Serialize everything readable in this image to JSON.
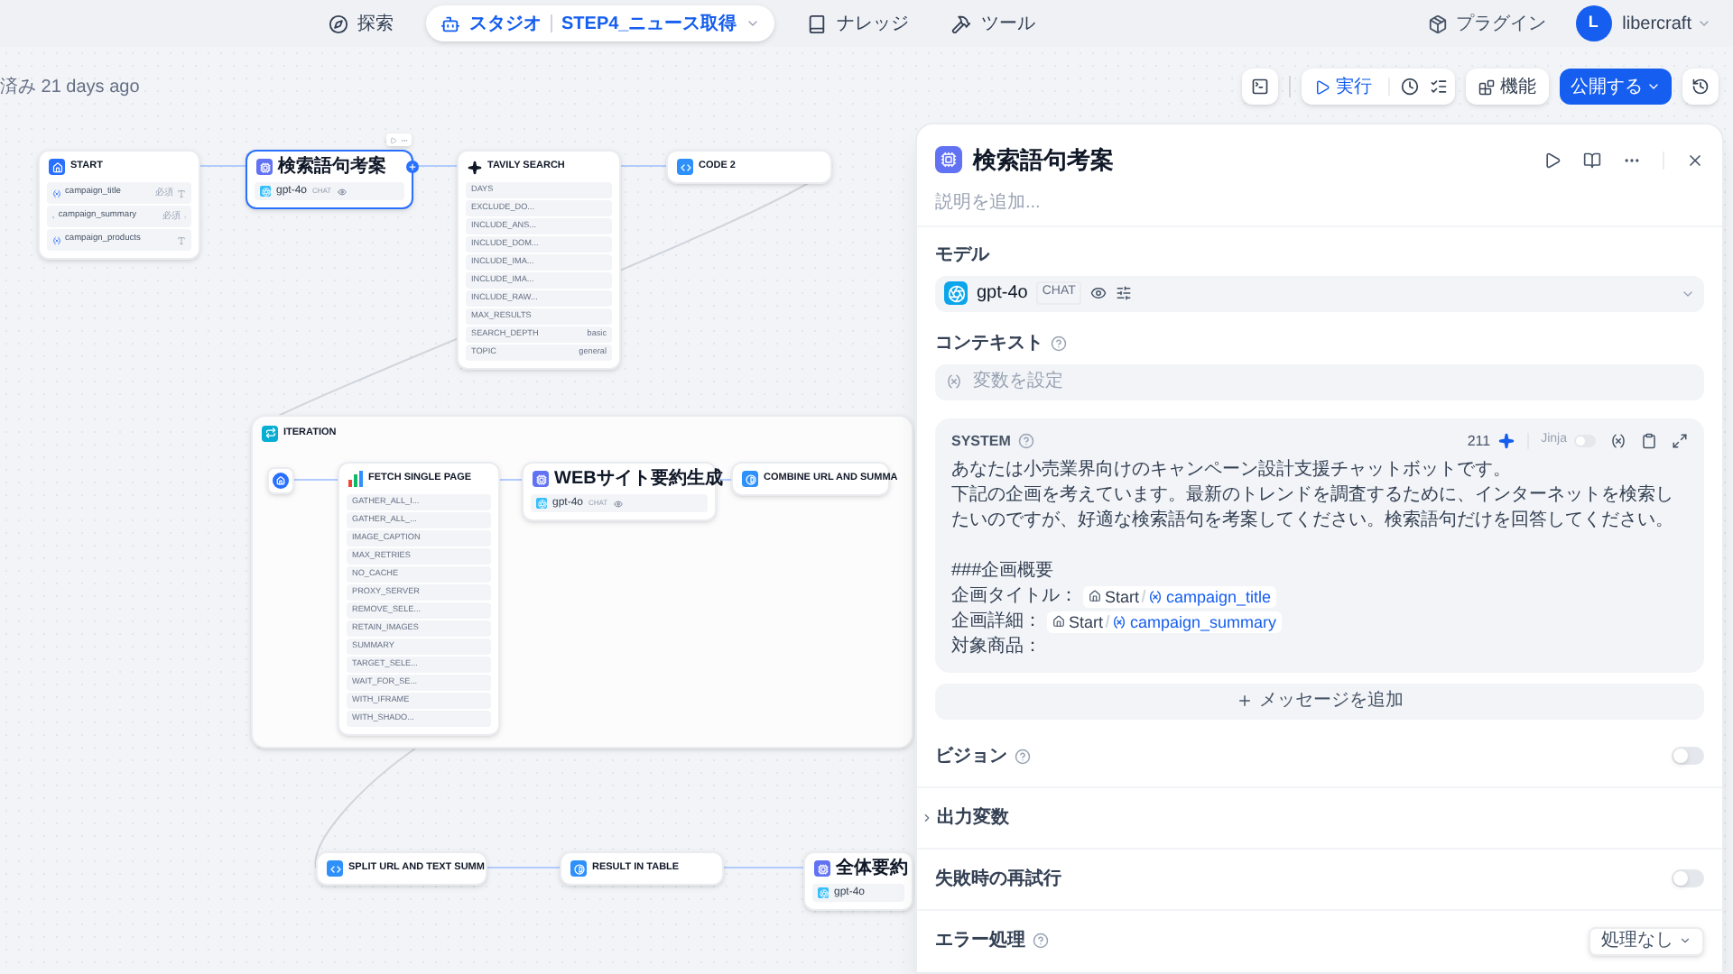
{
  "nav": {
    "items": [
      {
        "kind": "explore",
        "label": "探索",
        "selected": false
      },
      {
        "kind": "studio",
        "label": "スタジオ",
        "selected": true,
        "app": "STEP4_ニュース取得"
      },
      {
        "kind": "knowledge",
        "label": "ナレッジ",
        "selected": false
      },
      {
        "kind": "tools",
        "label": "ツール",
        "selected": false
      }
    ],
    "plugins": "プラグイン",
    "user": {
      "initial": "L",
      "name": "libercraft"
    }
  },
  "canvas": {
    "saved_status": "済み 21 days ago",
    "toolbar": {
      "run": "実行",
      "features": "機能",
      "publish": "公開する"
    },
    "nodes": [
      {
        "kind": "start",
        "title": "START",
        "selected": false,
        "rows": [
          {
            "kind": "input",
            "label": "campaign_title",
            "badge": "必須"
          },
          {
            "kind": "input",
            "label": "campaign_summary",
            "badge": "必須"
          },
          {
            "kind": "input",
            "label": "campaign_products"
          }
        ]
      },
      {
        "kind": "llm",
        "title": "検索語句考案",
        "selected": true,
        "rows": [
          {
            "kind": "model",
            "label": "gpt-4o",
            "badge": "CHAT"
          }
        ]
      },
      {
        "kind": "tavily",
        "title": "TAVILY SEARCH",
        "selected": false,
        "rows": [
          {
            "kind": "param",
            "label": "DAYS"
          },
          {
            "kind": "param",
            "label": "EXCLUDE_DO..."
          },
          {
            "kind": "param",
            "label": "INCLUDE_ANS..."
          },
          {
            "kind": "param",
            "label": "INCLUDE_DOM..."
          },
          {
            "kind": "param",
            "label": "INCLUDE_IMA..."
          },
          {
            "kind": "param",
            "label": "INCLUDE_IMA..."
          },
          {
            "kind": "param",
            "label": "INCLUDE_RAW..."
          },
          {
            "kind": "param",
            "label": "MAX_RESULTS"
          },
          {
            "kind": "param",
            "label": "SEARCH_DEPTH",
            "value": "basic"
          },
          {
            "kind": "param",
            "label": "TOPIC",
            "value": "general"
          }
        ]
      },
      {
        "kind": "code",
        "title": "CODE 2",
        "selected": false
      },
      {
        "kind": "code",
        "title": "SPLIT URL AND TEXT SUMM",
        "selected": false
      },
      {
        "kind": "template",
        "title": "RESULT IN TABLE",
        "selected": false
      },
      {
        "kind": "llm",
        "title": "全体要約",
        "selected": false,
        "rows": [
          {
            "kind": "model",
            "label": "gpt-4o"
          }
        ]
      }
    ],
    "iteration": {
      "title": "ITERATION",
      "nodes": [
        {
          "kind": "iteration-start",
          "selected": false
        },
        {
          "kind": "fetch",
          "title": "FETCH SINGLE PAGE",
          "selected": false,
          "rows": [
            {
              "kind": "param",
              "label": "GATHER_ALL_I..."
            },
            {
              "kind": "param",
              "label": "GATHER_ALL_..."
            },
            {
              "kind": "param",
              "label": "IMAGE_CAPTION"
            },
            {
              "kind": "param",
              "label": "MAX_RETRIES"
            },
            {
              "kind": "param",
              "label": "NO_CACHE"
            },
            {
              "kind": "param",
              "label": "PROXY_SERVER"
            },
            {
              "kind": "param",
              "label": "REMOVE_SELE..."
            },
            {
              "kind": "param",
              "label": "RETAIN_IMAGES"
            },
            {
              "kind": "param",
              "label": "SUMMARY"
            },
            {
              "kind": "param",
              "label": "TARGET_SELE..."
            },
            {
              "kind": "param",
              "label": "WAIT_FOR_SE..."
            },
            {
              "kind": "param",
              "label": "WITH_IFRAME"
            },
            {
              "kind": "param",
              "label": "WITH_SHADO..."
            }
          ]
        },
        {
          "kind": "llm",
          "title": "WEBサイト要約生成",
          "selected": false,
          "rows": [
            {
              "kind": "model",
              "label": "gpt-4o",
              "badge": "CHAT"
            }
          ]
        },
        {
          "kind": "template",
          "title": "COMBINE URL AND SUMMA",
          "selected": false
        }
      ]
    }
  },
  "panel": {
    "title": "検索語句考案",
    "description_placeholder": "説明を追加...",
    "model": {
      "label": "モデル",
      "name": "gpt-4o",
      "mode": "CHAT"
    },
    "context": {
      "label": "コンテキスト",
      "placeholder": "変数を設定"
    },
    "system": {
      "role": "SYSTEM",
      "count": "211",
      "jinja": {
        "label": "Jinja",
        "on": false
      },
      "lines": [
        {
          "kind": "text",
          "text": "あなたは小売業界向けのキャンペーン設計支援チャットボットです。"
        },
        {
          "kind": "text",
          "text": "下記の企画を考えています。最新のトレンドを調査するために、インターネットを検索したいのですが、好適な検索語句を考案してください。検索語句だけを回答してください。"
        },
        {
          "kind": "blank"
        },
        {
          "kind": "text",
          "text": "###企画概要"
        },
        {
          "kind": "var",
          "label": "企画タイトル：",
          "node": "Start",
          "variable": "campaign_title"
        },
        {
          "kind": "var",
          "label": "企画詳細：",
          "node": "Start",
          "variable": "campaign_summary"
        },
        {
          "kind": "text",
          "text": "対象商品："
        }
      ]
    },
    "add_message": "メッセージを追加",
    "settings": [
      {
        "kind": "toggle",
        "label": "ビジョン",
        "help": true,
        "on": false
      },
      {
        "kind": "section",
        "label": "出力変数",
        "help": false,
        "expanded": false
      },
      {
        "kind": "toggle",
        "label": "失敗時の再試行",
        "help": false,
        "on": false
      },
      {
        "kind": "select",
        "label": "エラー処理",
        "help": true,
        "value": "処理なし"
      }
    ]
  }
}
